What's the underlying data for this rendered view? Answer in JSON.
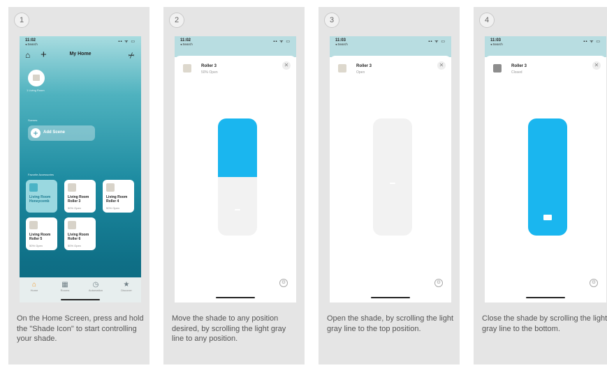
{
  "panels": [
    {
      "step": "1",
      "caption": "On the Home Screen, press and hold the \"Shade Icon\" to start controlling your shade.",
      "screen": {
        "time": "11:02",
        "back": "◂ Search",
        "signal": "▪▪ ᯤ ▭",
        "title": "My Home",
        "circle_caption": "1 Living Room",
        "scenes_label": "Scenes",
        "add_scene": "Add Scene",
        "accessories_label": "Favorite Accessories",
        "tiles": [
          {
            "name": "Living Room Honeycomb",
            "status": ""
          },
          {
            "name": "Living Room Roller 3",
            "status": "50% Open"
          },
          {
            "name": "Living Room Roller 4",
            "status": "50% Open"
          },
          {
            "name": "Living Room Roller 5",
            "status": "50% Open"
          },
          {
            "name": "Living Room Roller 6",
            "status": "50% Open"
          }
        ],
        "tabs": [
          {
            "icon": "home-icon",
            "glyph": "⌂",
            "label": "Home"
          },
          {
            "icon": "rooms-icon",
            "glyph": "▦",
            "label": "Rooms"
          },
          {
            "icon": "automation-icon",
            "glyph": "◷",
            "label": "Automation"
          },
          {
            "icon": "discover-icon",
            "glyph": "★",
            "label": "Discover"
          }
        ]
      }
    },
    {
      "step": "2",
      "caption": "Move the shade to any position desired, by scrolling the light gray line to any position.",
      "screen": {
        "time": "11:02",
        "back": "◂ Search",
        "signal": "▪▪ ᯤ ▭",
        "name": "Roller 3",
        "state": "50% Open",
        "open_fraction": 0.5
      }
    },
    {
      "step": "3",
      "caption": "Open the shade, by scrolling the light gray line to the top position.",
      "screen": {
        "time": "11:03",
        "back": "◂ Search",
        "signal": "▪▪ ᯤ ▭",
        "name": "Roller 3",
        "state": "Open",
        "open_fraction": 1.0
      }
    },
    {
      "step": "4",
      "caption": "Close the shade by scrolling the light gray line to the bottom.",
      "screen": {
        "time": "11:03",
        "back": "◂ Search",
        "signal": "▪▪ ᯤ ▭",
        "name": "Roller 3",
        "state": "Closed",
        "open_fraction": 0.0
      }
    }
  ],
  "colors": {
    "accent": "#1ab6ef",
    "panel": "#e5e5e5",
    "home_teal": "#1c8aa0",
    "active_tab": "#f39c2e"
  }
}
